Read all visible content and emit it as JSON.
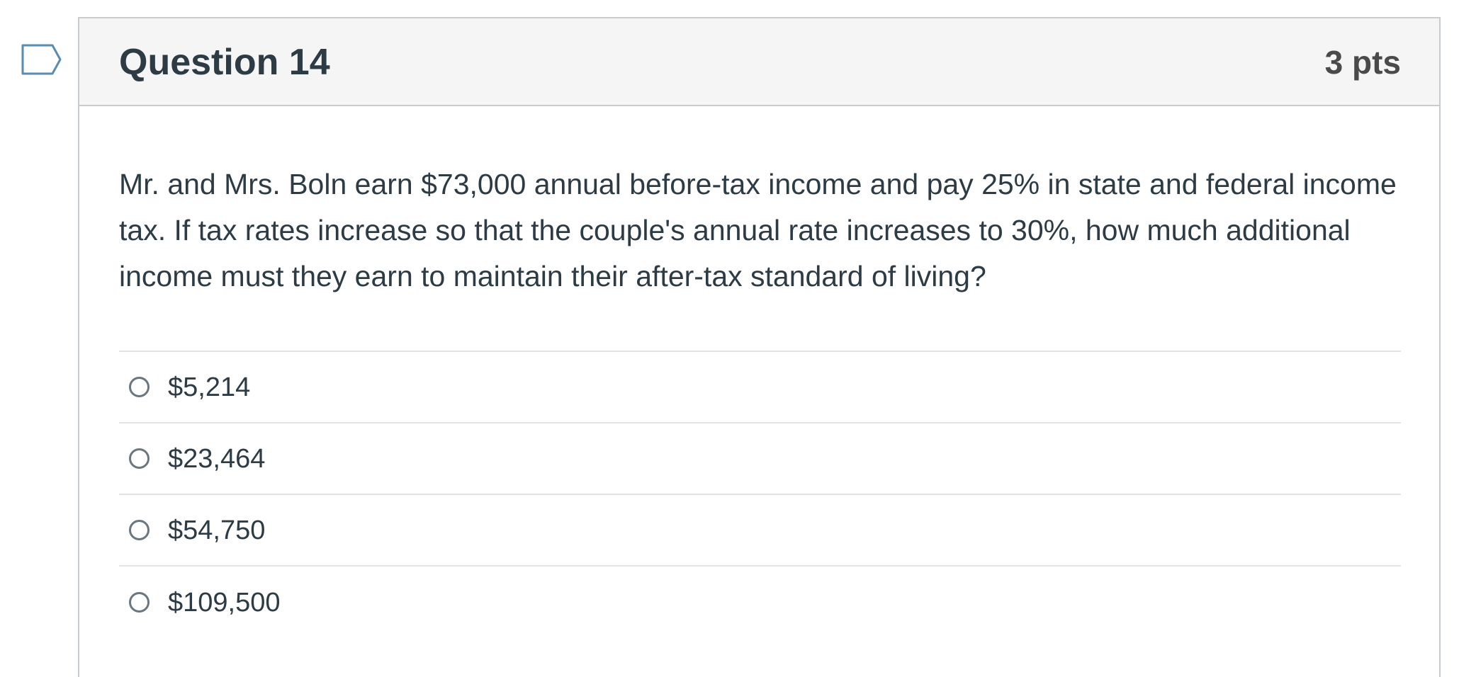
{
  "question": {
    "title": "Question 14",
    "points": "3 pts",
    "text": "Mr. and Mrs. Boln earn $73,000 annual before-tax income and pay 25% in state and federal income tax. If tax rates increase so that the couple's annual rate increases to 30%, how much additional income must they earn to maintain their after-tax standard of living?",
    "flag_icon": "flag-outline-icon",
    "answers": [
      {
        "label": "$5,214"
      },
      {
        "label": "$23,464"
      },
      {
        "label": "$54,750"
      },
      {
        "label": "$109,500"
      }
    ]
  },
  "colors": {
    "text": "#2d3b45",
    "header_bg": "#f5f5f5",
    "border": "#c7cdd1",
    "flag_stroke": "#5a8bb0"
  }
}
